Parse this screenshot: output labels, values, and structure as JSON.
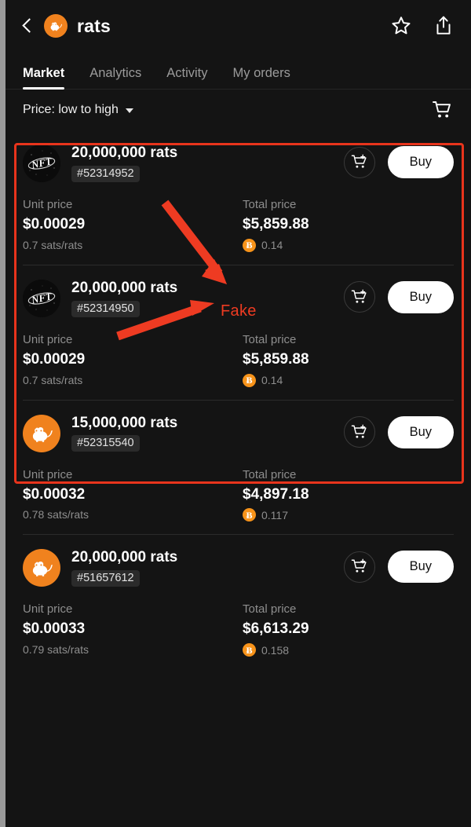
{
  "header": {
    "back_icon": "chevron-left-icon",
    "collection_avatar_icon": "rat-avatar-icon",
    "title": "rats",
    "favorite_icon": "star-icon",
    "share_icon": "share-icon"
  },
  "tabs": [
    {
      "label": "Market",
      "active": true
    },
    {
      "label": "Analytics",
      "active": false
    },
    {
      "label": "Activity",
      "active": false
    },
    {
      "label": "My orders",
      "active": false
    }
  ],
  "toolbar": {
    "sort_label": "Price: low to high",
    "sort_caret_icon": "chevron-down-icon",
    "cart_icon": "shopping-cart-icon"
  },
  "labels": {
    "unit_price": "Unit price",
    "total_price": "Total price",
    "buy": "Buy",
    "add_to_cart_icon": "cart-plus-icon",
    "btc_symbol": "Ƀ"
  },
  "annotation": {
    "fake_text": "Fake",
    "color": "#ee3b22"
  },
  "listings": [
    {
      "avatar": "nft-placeholder-icon",
      "avatar_type": "nft",
      "amount": "20,000,000 rats",
      "id": "#52314952",
      "unit_price": "$0.00029",
      "unit_rate": "0.7 sats/rats",
      "total_price": "$5,859.88",
      "total_btc": "0.14",
      "buy_label": "Buy",
      "flagged": true
    },
    {
      "avatar": "nft-placeholder-icon",
      "avatar_type": "nft",
      "amount": "20,000,000 rats",
      "id": "#52314950",
      "unit_price": "$0.00029",
      "unit_rate": "0.7 sats/rats",
      "total_price": "$5,859.88",
      "total_btc": "0.14",
      "buy_label": "Buy",
      "flagged": true
    },
    {
      "avatar": "rat-avatar-icon",
      "avatar_type": "rat",
      "amount": "15,000,000 rats",
      "id": "#52315540",
      "unit_price": "$0.00032",
      "unit_rate": "0.78 sats/rats",
      "total_price": "$4,897.18",
      "total_btc": "0.117",
      "buy_label": "Buy",
      "flagged": false
    },
    {
      "avatar": "rat-avatar-icon",
      "avatar_type": "rat",
      "amount": "20,000,000 rats",
      "id": "#51657612",
      "unit_price": "$0.00033",
      "unit_rate": "0.79 sats/rats",
      "total_price": "$6,613.29",
      "total_btc": "0.158",
      "buy_label": "Buy",
      "flagged": false
    }
  ]
}
